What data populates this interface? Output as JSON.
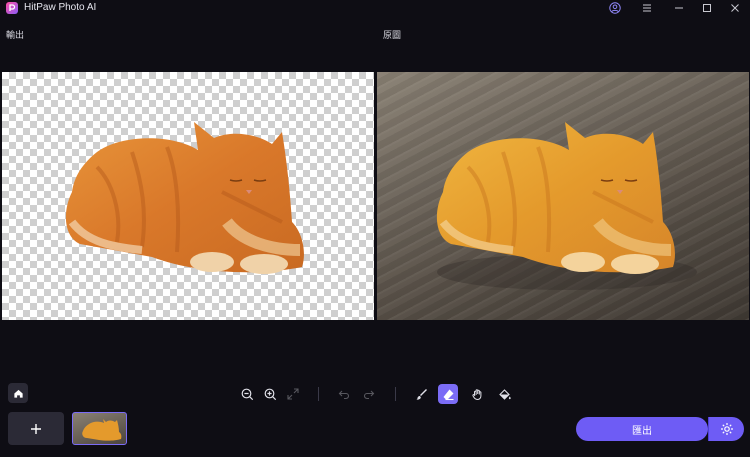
{
  "app": {
    "title": "HitPaw Photo AI",
    "brand_colors": [
      "#ff4fa3",
      "#8b5cf6"
    ]
  },
  "titlebar": {
    "icons": [
      "account-icon",
      "menu-icon",
      "minimize-icon",
      "maximize-icon",
      "close-icon"
    ]
  },
  "preview": {
    "left_label": "輸出",
    "right_label": "原圖",
    "left_background": "transparent-checkerboard"
  },
  "toolbar": {
    "home_icon": "home-icon",
    "tools": [
      "zoom-out-icon",
      "zoom-in-icon",
      "fit-screen-icon",
      "undo-icon",
      "redo-icon",
      "brush-icon",
      "eraser-icon",
      "hand-icon",
      "fill-icon"
    ],
    "active_tool": "eraser-icon",
    "disabled_tools": [
      "fit-screen-icon",
      "undo-icon",
      "redo-icon"
    ]
  },
  "bottom": {
    "add_icon": "plus-icon",
    "export_label": "匯出",
    "accent_color": "#6e5cf5"
  }
}
